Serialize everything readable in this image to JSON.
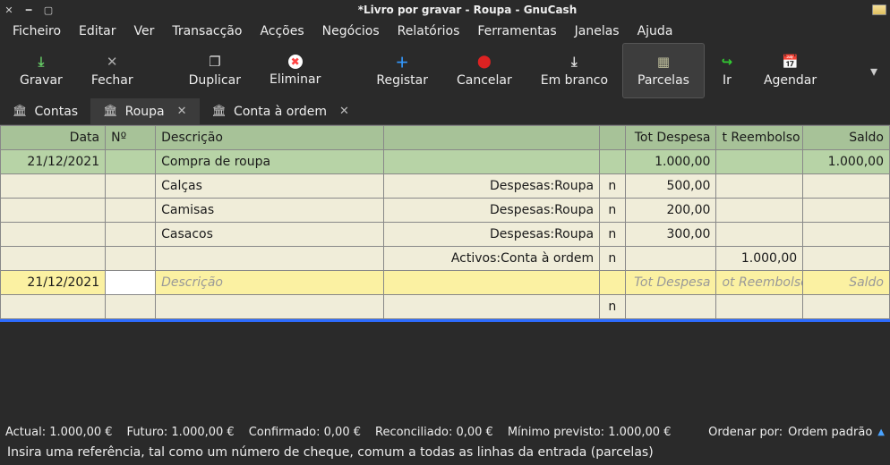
{
  "window": {
    "title": "*Livro por gravar - Roupa - GnuCash"
  },
  "menu": [
    "Ficheiro",
    "Editar",
    "Ver",
    "Transacção",
    "Acções",
    "Negócios",
    "Relatórios",
    "Ferramentas",
    "Janelas",
    "Ajuda"
  ],
  "toolbar": {
    "gravar": {
      "label": "Gravar"
    },
    "fechar": {
      "label": "Fechar"
    },
    "duplicar": {
      "label": "Duplicar"
    },
    "eliminar": {
      "label": "Eliminar"
    },
    "registar": {
      "label": "Registar"
    },
    "cancelar": {
      "label": "Cancelar"
    },
    "branco": {
      "label": "Em branco"
    },
    "parcelas": {
      "label": "Parcelas"
    },
    "ir": {
      "label": "Ir"
    },
    "agendar": {
      "label": "Agendar"
    }
  },
  "tabs": [
    {
      "label": "Contas",
      "closable": false,
      "active": false
    },
    {
      "label": "Roupa",
      "closable": true,
      "active": true
    },
    {
      "label": "Conta à ordem",
      "closable": true,
      "active": false
    }
  ],
  "columns": {
    "data": "Data",
    "no": "Nº",
    "descricao": "Descrição",
    "tot_despesa": "Tot Despesa",
    "tot_reembolso": "t Reembolso",
    "saldo": "Saldo"
  },
  "rows": {
    "head": {
      "date": "21/12/2021",
      "desc": "Compra de roupa",
      "amt1": "1.000,00",
      "bal": "1.000,00"
    },
    "splits": [
      {
        "desc": "Calças",
        "acct": "Despesas:Roupa",
        "n": "n",
        "amt1": "500,00"
      },
      {
        "desc": "Camisas",
        "acct": "Despesas:Roupa",
        "n": "n",
        "amt1": "200,00"
      },
      {
        "desc": "Casacos",
        "acct": "Despesas:Roupa",
        "n": "n",
        "amt1": "300,00"
      },
      {
        "desc": "",
        "acct": "Activos:Conta à ordem",
        "n": "n",
        "amt2": "1.000,00"
      }
    ],
    "empty": {
      "date": "21/12/2021",
      "desc_ph": "Descrição",
      "amt1_ph": "Tot Despesa",
      "amt2_ph": "ot Reembolso",
      "bal_ph": "Saldo"
    },
    "blank": {
      "n": "n"
    }
  },
  "status": {
    "actual": "Actual: 1.000,00 €",
    "futuro": "Futuro: 1.000,00 €",
    "confirmado": "Confirmado: 0,00 €",
    "reconciliado": "Reconciliado: 0,00 €",
    "minimo": "Mínimo previsto: 1.000,00 €",
    "sort_label": "Ordenar por:",
    "sort_value": "Ordem padrão"
  },
  "hint": "Insira uma referência, tal como um número de cheque, comum a todas as linhas da entrada (parcelas)"
}
